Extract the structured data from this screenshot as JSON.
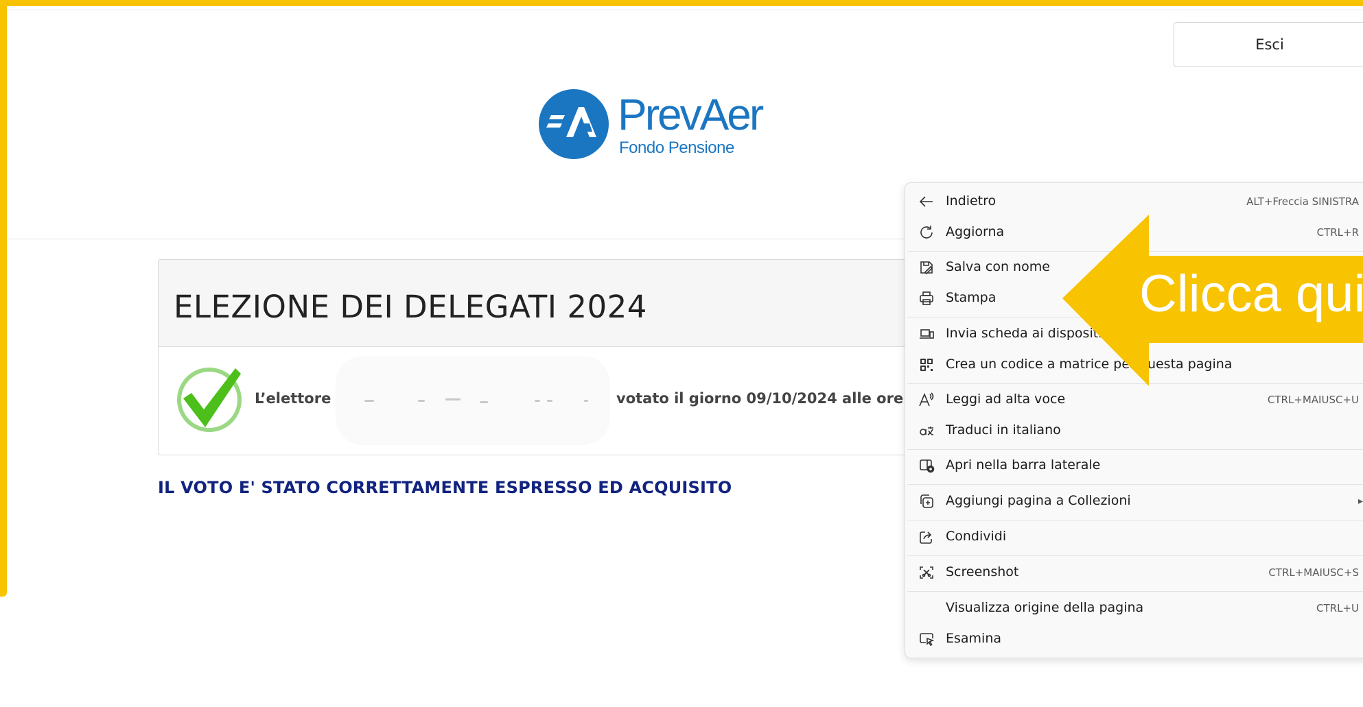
{
  "header": {
    "exit_label": "Esci"
  },
  "logo": {
    "name": "PrevAer",
    "subtitle": "Fondo Pensione"
  },
  "election": {
    "title": "ELEZIONE DEI DELEGATI 2024",
    "voter_label": "L’elettore",
    "vote_info": "votato il giorno 09/10/2024 alle ore 10:",
    "confirmation": "IL VOTO E' STATO CORRETTAMENTE ESPRESSO ED ACQUISITO"
  },
  "context_menu": {
    "items": [
      {
        "label": "Indietro",
        "shortcut": "ALT+Freccia SINISTRA",
        "icon": "arrow-left-icon"
      },
      {
        "label": "Aggiorna",
        "shortcut": "CTRL+R",
        "icon": "refresh-icon"
      },
      {
        "label": "Salva con nome",
        "shortcut": "",
        "icon": "save-as-icon"
      },
      {
        "label": "Stampa",
        "shortcut": "",
        "icon": "print-icon"
      },
      {
        "label": "Invia scheda ai dispositivi",
        "shortcut": "",
        "icon": "send-to-devices-icon"
      },
      {
        "label": "Crea un codice a matrice per questa pagina",
        "shortcut": "",
        "icon": "qr-code-icon"
      },
      {
        "label": "Leggi ad alta voce",
        "shortcut": "CTRL+MAIUSC+U",
        "icon": "read-aloud-icon"
      },
      {
        "label": "Traduci in italiano",
        "shortcut": "",
        "icon": "translate-icon"
      },
      {
        "label": "Apri nella barra laterale",
        "shortcut": "",
        "icon": "sidebar-icon"
      },
      {
        "label": "Aggiungi pagina a Collezioni",
        "shortcut": "",
        "icon": "collections-icon"
      },
      {
        "label": "Condividi",
        "shortcut": "",
        "icon": "share-icon"
      },
      {
        "label": "Screenshot",
        "shortcut": "CTRL+MAIUSC+S",
        "icon": "screenshot-icon"
      },
      {
        "label": "Visualizza origine della pagina",
        "shortcut": "CTRL+U",
        "icon": ""
      },
      {
        "label": "Esamina",
        "shortcut": "",
        "icon": "inspect-icon"
      }
    ]
  },
  "callout": {
    "text": "Clicca qui",
    "color": "#f8c300"
  },
  "colors": {
    "frame": "#f8c300",
    "brand_blue": "#1b76c2",
    "confirm_text": "#12237f",
    "check_green": "#4cbf1a"
  }
}
